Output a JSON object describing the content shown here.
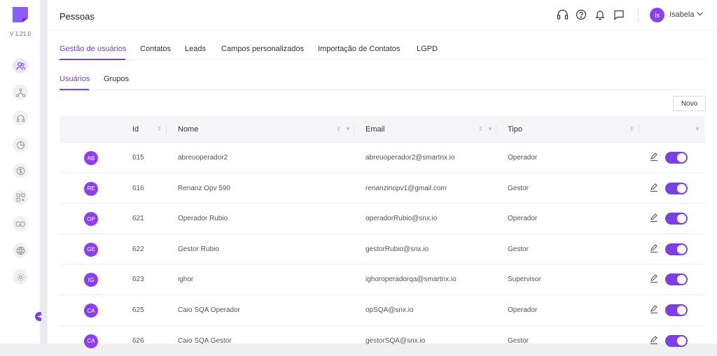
{
  "sidebar": {
    "version": "V 1.21.0",
    "items": [
      {
        "icon": "users-icon",
        "active": true
      },
      {
        "icon": "hierarchy-icon"
      },
      {
        "icon": "headset-icon"
      },
      {
        "icon": "pie-chart-icon"
      },
      {
        "icon": "dollar-icon"
      },
      {
        "icon": "apps-grid-icon"
      },
      {
        "icon": "handshake-icon"
      },
      {
        "icon": "globe-icon"
      },
      {
        "icon": "gear-icon"
      }
    ]
  },
  "header": {
    "title": "Pessoas",
    "user_initials": "Is",
    "user_name": "Isabela"
  },
  "tabs": [
    "Gestão de usuários",
    "Contatos",
    "Leads",
    "Campos personalizados",
    "Importação de Contatos",
    "LGPD"
  ],
  "subtabs": [
    "Usuários",
    "Grupos"
  ],
  "new_button": "Novo",
  "table": {
    "columns": [
      "Id",
      "Nome",
      "Email",
      "Tipo"
    ],
    "rows": [
      {
        "initials": "AB",
        "id": "615",
        "name": "abreuoperador2",
        "email": "abreuoperador2@smartnx.io",
        "type": "Operador"
      },
      {
        "initials": "RE",
        "id": "616",
        "name": "Renanz Opv 590",
        "email": "renanzinopv1@gmail.com",
        "type": "Gestor"
      },
      {
        "initials": "OP",
        "id": "621",
        "name": "Operador Rubio",
        "email": "operadorRubio@snx.io",
        "type": "Operador"
      },
      {
        "initials": "GE",
        "id": "622",
        "name": "Gestor Rubio",
        "email": "gestorRubio@snx.io",
        "type": "Gestor"
      },
      {
        "initials": "IG",
        "id": "623",
        "name": "ighor",
        "email": "ighoroperadorqa@smartnx.io",
        "type": "Supervisor"
      },
      {
        "initials": "CA",
        "id": "625",
        "name": "Caio SQA Operador",
        "email": "opSQA@snx.io",
        "type": "Operador"
      },
      {
        "initials": "CA",
        "id": "626",
        "name": "Caio SQA Gestor",
        "email": "gestorSQA@snx.io",
        "type": "Gestor"
      }
    ]
  },
  "colors": {
    "accent": "#7b3fe4",
    "avatar": "#8b3ff0"
  }
}
